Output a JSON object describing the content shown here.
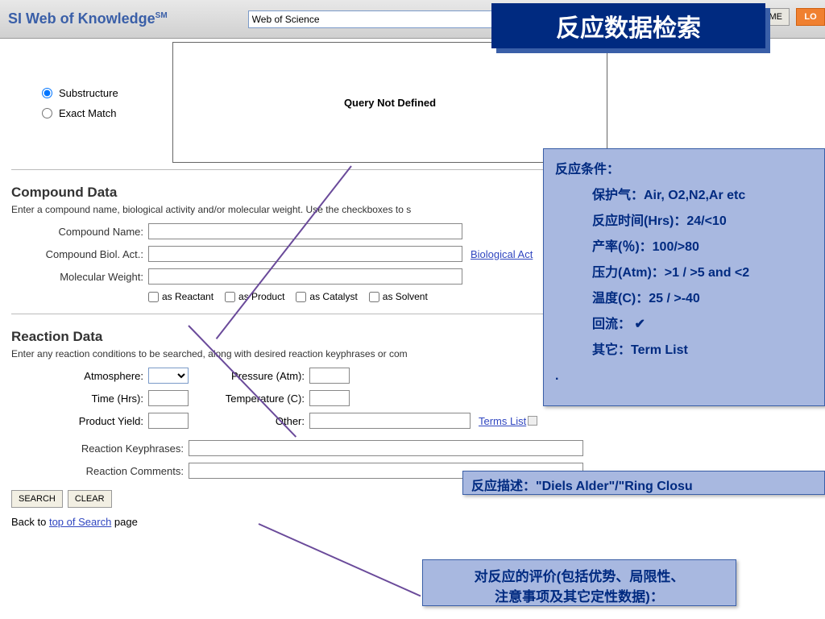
{
  "topbar": {
    "brand": "SI Web of Knowledge",
    "brand_sm": "SM",
    "db_select": "Web of Science",
    "home": "OME",
    "logout": "LO"
  },
  "banner": "反应数据检索",
  "search_mode": {
    "substructure": "Substructure",
    "exact": "Exact Match"
  },
  "query_text": "Query Not Defined",
  "compound": {
    "title": "Compound Data",
    "desc": "Enter a compound name, biological activity and/or molecular weight. Use the checkboxes to s",
    "name_label": "Compound Name:",
    "biol_label": "Compound Biol. Act.:",
    "mw_label": "Molecular Weight:",
    "bio_link": "Biological Act",
    "cb_reactant": "as Reactant",
    "cb_product": "as Product",
    "cb_catalyst": "as Catalyst",
    "cb_solvent": "as Solvent"
  },
  "reaction": {
    "title": "Reaction Data",
    "desc": "Enter any reaction conditions to be searched, along with desired reaction keyphrases or com",
    "atm_label": "Atmosphere:",
    "time_label": "Time (Hrs):",
    "yield_label": "Product Yield:",
    "pressure_label": "Pressure (Atm):",
    "temp_label": "Temperature (C):",
    "other_label": "Other:",
    "terms_link": "Terms List",
    "keyphrase_label": "Reaction Keyphrases:",
    "comments_label": "Reaction Comments:"
  },
  "buttons": {
    "search": "SEARCH",
    "clear": "CLEAR"
  },
  "back": {
    "prefix": "Back to ",
    "link": "top of Search",
    "suffix": " page"
  },
  "overlay1": {
    "l0": "反应条件：",
    "l1": "保护气：Air, O2,N2,Ar etc",
    "l2": "反应时间(Hrs)：24/<10",
    "l3": "产率(％)：100/>80",
    "l4": "压力(Atm)：>1 / >5 and <2",
    "l5": "温度(C)：25 / >-40",
    "l6": "回流： ✔",
    "l7": "其它：Term List",
    "l8": "."
  },
  "overlay2": "反应描述：\"Diels Alder\"/\"Ring Closu",
  "overlay3": {
    "l1": "对反应的评价(包括优势、局限性、",
    "l2": "注意事项及其它定性数据)："
  }
}
